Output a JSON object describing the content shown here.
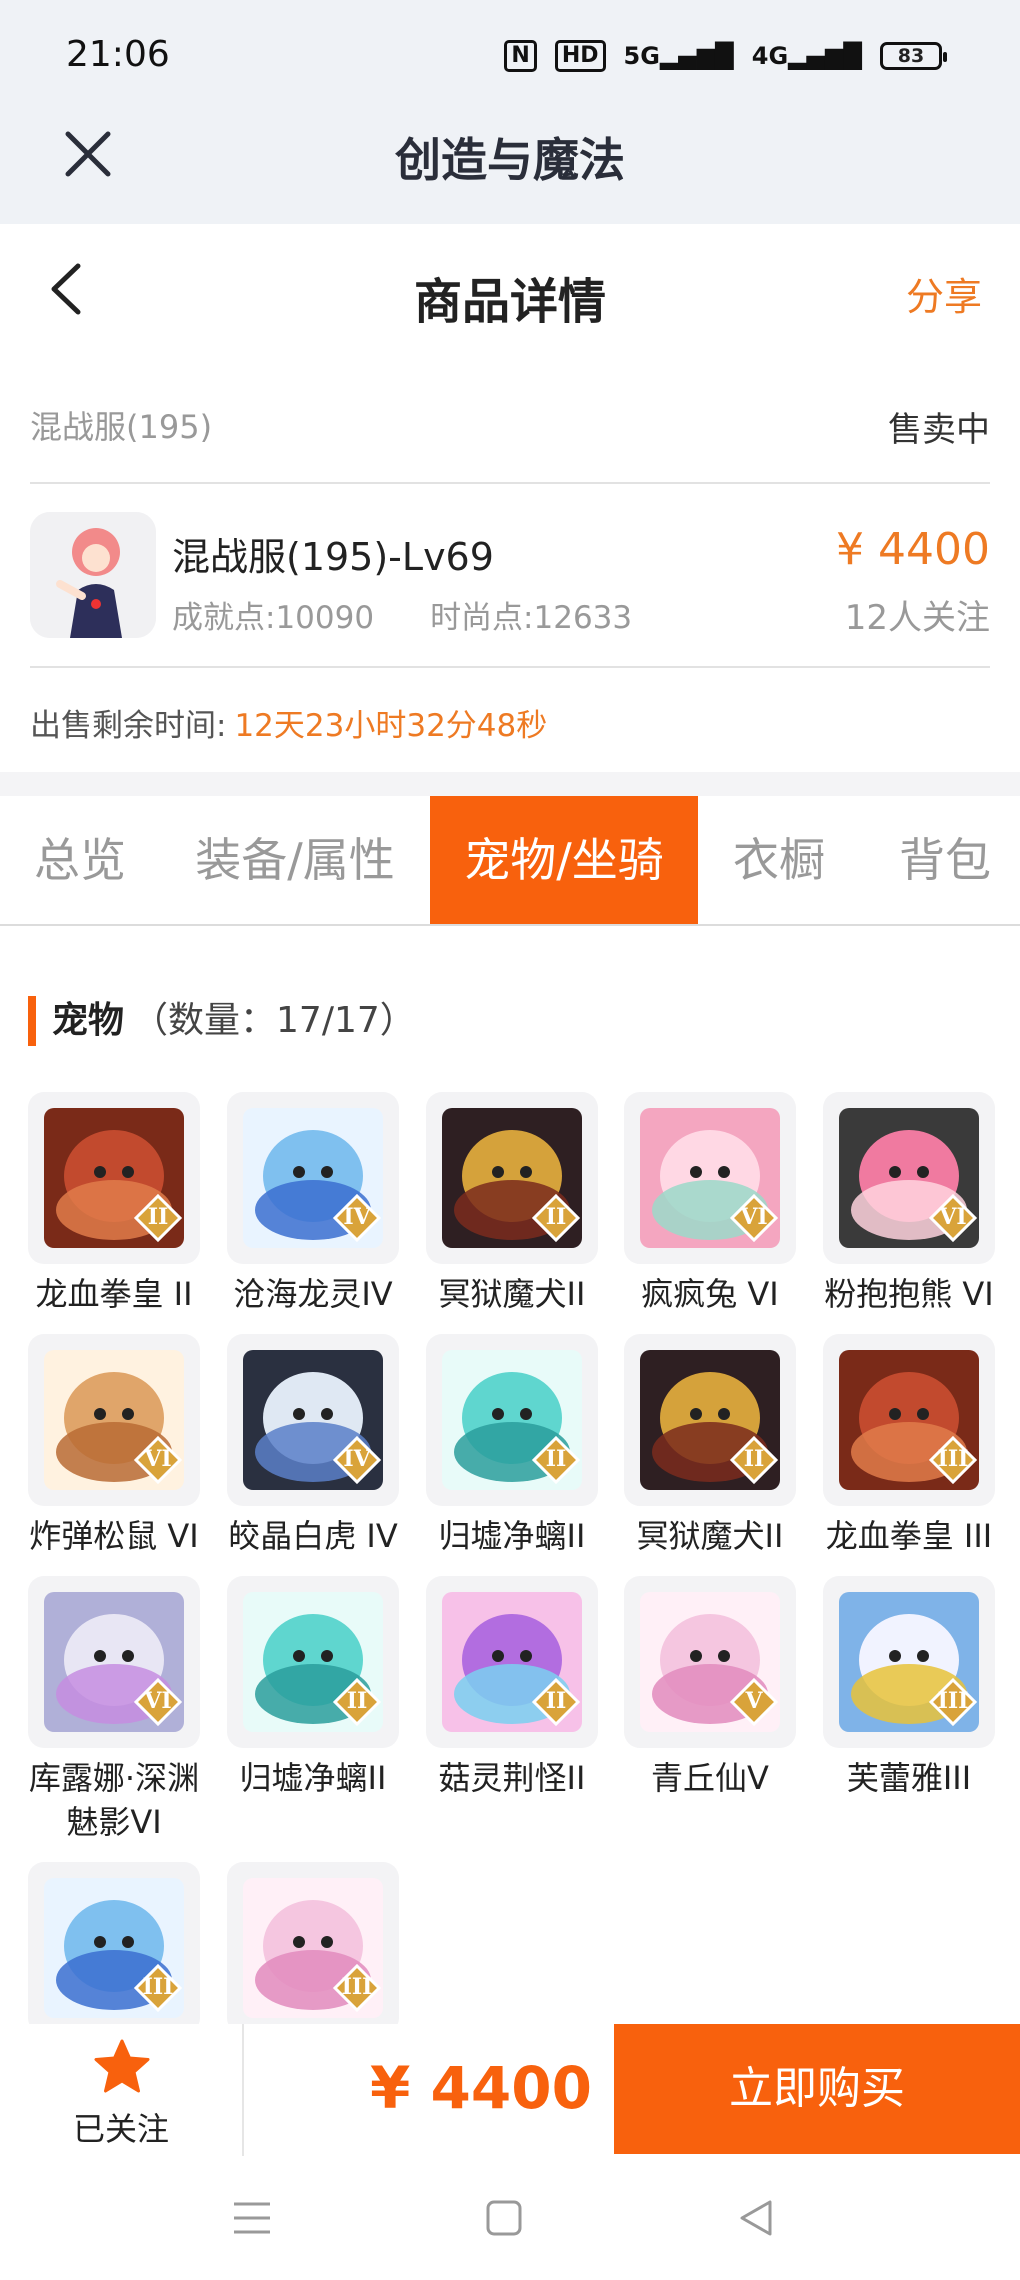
{
  "status_bar": {
    "time": "21:06",
    "nfc": "N",
    "hd": "HD",
    "net1": "5G",
    "net2": "4G",
    "battery": "83"
  },
  "app_bar": {
    "title": "创造与魔法"
  },
  "header": {
    "title": "商品详情",
    "share_label": "分享"
  },
  "server_row": {
    "server": "混战服(195)",
    "status": "售卖中"
  },
  "product": {
    "name": "混战服(195)-Lv69",
    "achievement": "成就点:10090",
    "fashion": "时尚点:12633",
    "price": "¥ 4400",
    "followers": "12人关注"
  },
  "time_remaining": {
    "label": "出售剩余时间:",
    "value": "12天23小时32分48秒"
  },
  "tabs": [
    {
      "label": "总览"
    },
    {
      "label": "装备/属性"
    },
    {
      "label": "宠物/坐骑"
    },
    {
      "label": "衣橱"
    },
    {
      "label": "背包"
    }
  ],
  "active_tab": "宠物/坐骑",
  "section": {
    "title": "宠物",
    "count": "（数量：17/17）"
  },
  "pets": [
    {
      "name": "龙血拳皇 II",
      "badge": "II",
      "icon": "dragon-fist-icon"
    },
    {
      "name": "沧海龙灵IV",
      "badge": "IV",
      "icon": "sea-dragon-spirit-icon"
    },
    {
      "name": "冥狱魔犬II",
      "badge": "II",
      "icon": "hell-hound-icon"
    },
    {
      "name": "疯疯兔 VI",
      "badge": "VI",
      "icon": "crazy-rabbit-icon"
    },
    {
      "name": "粉抱抱熊 VI",
      "badge": "VI",
      "icon": "pink-bear-icon"
    },
    {
      "name": "炸弹松鼠 VI",
      "badge": "VI",
      "icon": "bomb-squirrel-icon"
    },
    {
      "name": "皎晶白虎 IV",
      "badge": "IV",
      "icon": "crystal-tiger-icon"
    },
    {
      "name": "归墟净螭II",
      "badge": "II",
      "icon": "teal-dragon-icon"
    },
    {
      "name": "冥狱魔犬II",
      "badge": "II",
      "icon": "hell-hound-icon"
    },
    {
      "name": "龙血拳皇 III",
      "badge": "III",
      "icon": "dragon-fist-icon"
    },
    {
      "name": "库露娜·深渊魅影VI",
      "badge": "VI",
      "icon": "abyss-phantom-icon"
    },
    {
      "name": "归墟净螭II",
      "badge": "II",
      "icon": "teal-dragon-icon"
    },
    {
      "name": "菇灵荆怪II",
      "badge": "II",
      "icon": "mushroom-sprite-icon"
    },
    {
      "name": "青丘仙V",
      "badge": "V",
      "icon": "fox-fairy-icon"
    },
    {
      "name": "芙蕾雅III",
      "badge": "III",
      "icon": "freya-icon"
    },
    {
      "name": "",
      "badge": "III",
      "icon": "sea-dragon-spirit-icon"
    },
    {
      "name": "",
      "badge": "III",
      "icon": "fox-fairy-icon"
    }
  ],
  "bottom_bar": {
    "follow_label": "已关注",
    "price": "¥ 4400",
    "buy_label": "立即购买"
  },
  "colors": {
    "accent": "#f8610d",
    "price": "#ee7a23"
  }
}
